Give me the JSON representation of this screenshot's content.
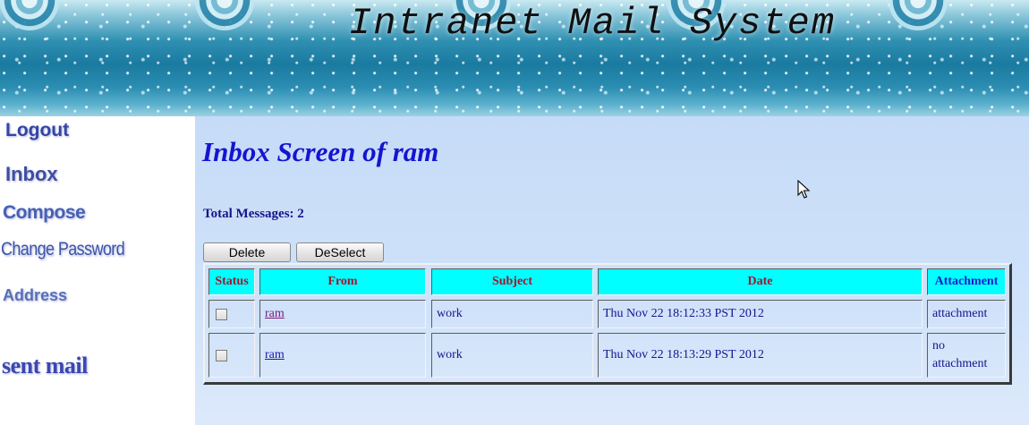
{
  "header": {
    "title": "Intranet Mail System"
  },
  "nav": {
    "logout": "Logout",
    "inbox": "Inbox",
    "compose": "Compose",
    "change_password": "Change Password",
    "address": "Address",
    "sent_mail": "sent mail"
  },
  "main": {
    "title": "Inbox Screen of ram",
    "total_label": "Total Messages:",
    "total_count": "2",
    "buttons": {
      "delete": "Delete",
      "deselect": "DeSelect"
    },
    "table": {
      "headers": [
        "Status",
        "From",
        "Subject",
        "Date",
        "Attachment"
      ],
      "rows": [
        {
          "from": "ram",
          "subject": "work",
          "date": "Thu Nov 22 18:12:33 PST 2012",
          "attachment_line1": "attachment",
          "attachment_line2": ""
        },
        {
          "from": "ram",
          "subject": "work",
          "date": "Thu Nov 22 18:13:29 PST 2012",
          "attachment_line1": "no",
          "attachment_line2": "attachment"
        }
      ]
    }
  },
  "colors": {
    "header_cell": "#00ffff",
    "header_text": "#a8122a",
    "title": "#1414d2",
    "content_bg": "#cfe2fa"
  }
}
